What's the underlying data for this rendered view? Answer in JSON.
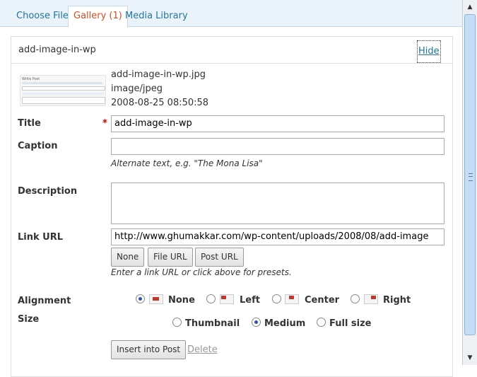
{
  "tabs": [
    {
      "label": "Choose File"
    },
    {
      "label": "Gallery (1)"
    },
    {
      "label": "Media Library"
    }
  ],
  "item": {
    "title": "add-image-in-wp",
    "hide_label": "Hide",
    "thumb_text": "Write Post",
    "filename": "add-image-in-wp.jpg",
    "mime": "image/jpeg",
    "date": "2008-08-25 08:50:58"
  },
  "form": {
    "title_label": "Title",
    "required_mark": "*",
    "title_value": "add-image-in-wp",
    "caption_label": "Caption",
    "caption_value": "",
    "caption_help": "Alternate text, e.g. \"The Mona Lisa\"",
    "description_label": "Description",
    "description_value": "",
    "link_label": "Link URL",
    "link_value": "http://www.ghumakkar.com/wp-content/uploads/2008/08/add-image",
    "link_buttons": [
      "None",
      "File URL",
      "Post URL"
    ],
    "link_help": "Enter a link URL or click above for presets.",
    "alignment_label": "Alignment",
    "alignment_options": [
      "None",
      "Left",
      "Center",
      "Right"
    ],
    "alignment_selected": "None",
    "size_label": "Size",
    "size_options": [
      "Thumbnail",
      "Medium",
      "Full size"
    ],
    "size_selected": "Medium",
    "insert_label": "Insert into Post",
    "delete_label": "Delete"
  },
  "colors": {
    "link": "#21759b",
    "active_tab": "#d54e21",
    "required": "#cc0000"
  }
}
